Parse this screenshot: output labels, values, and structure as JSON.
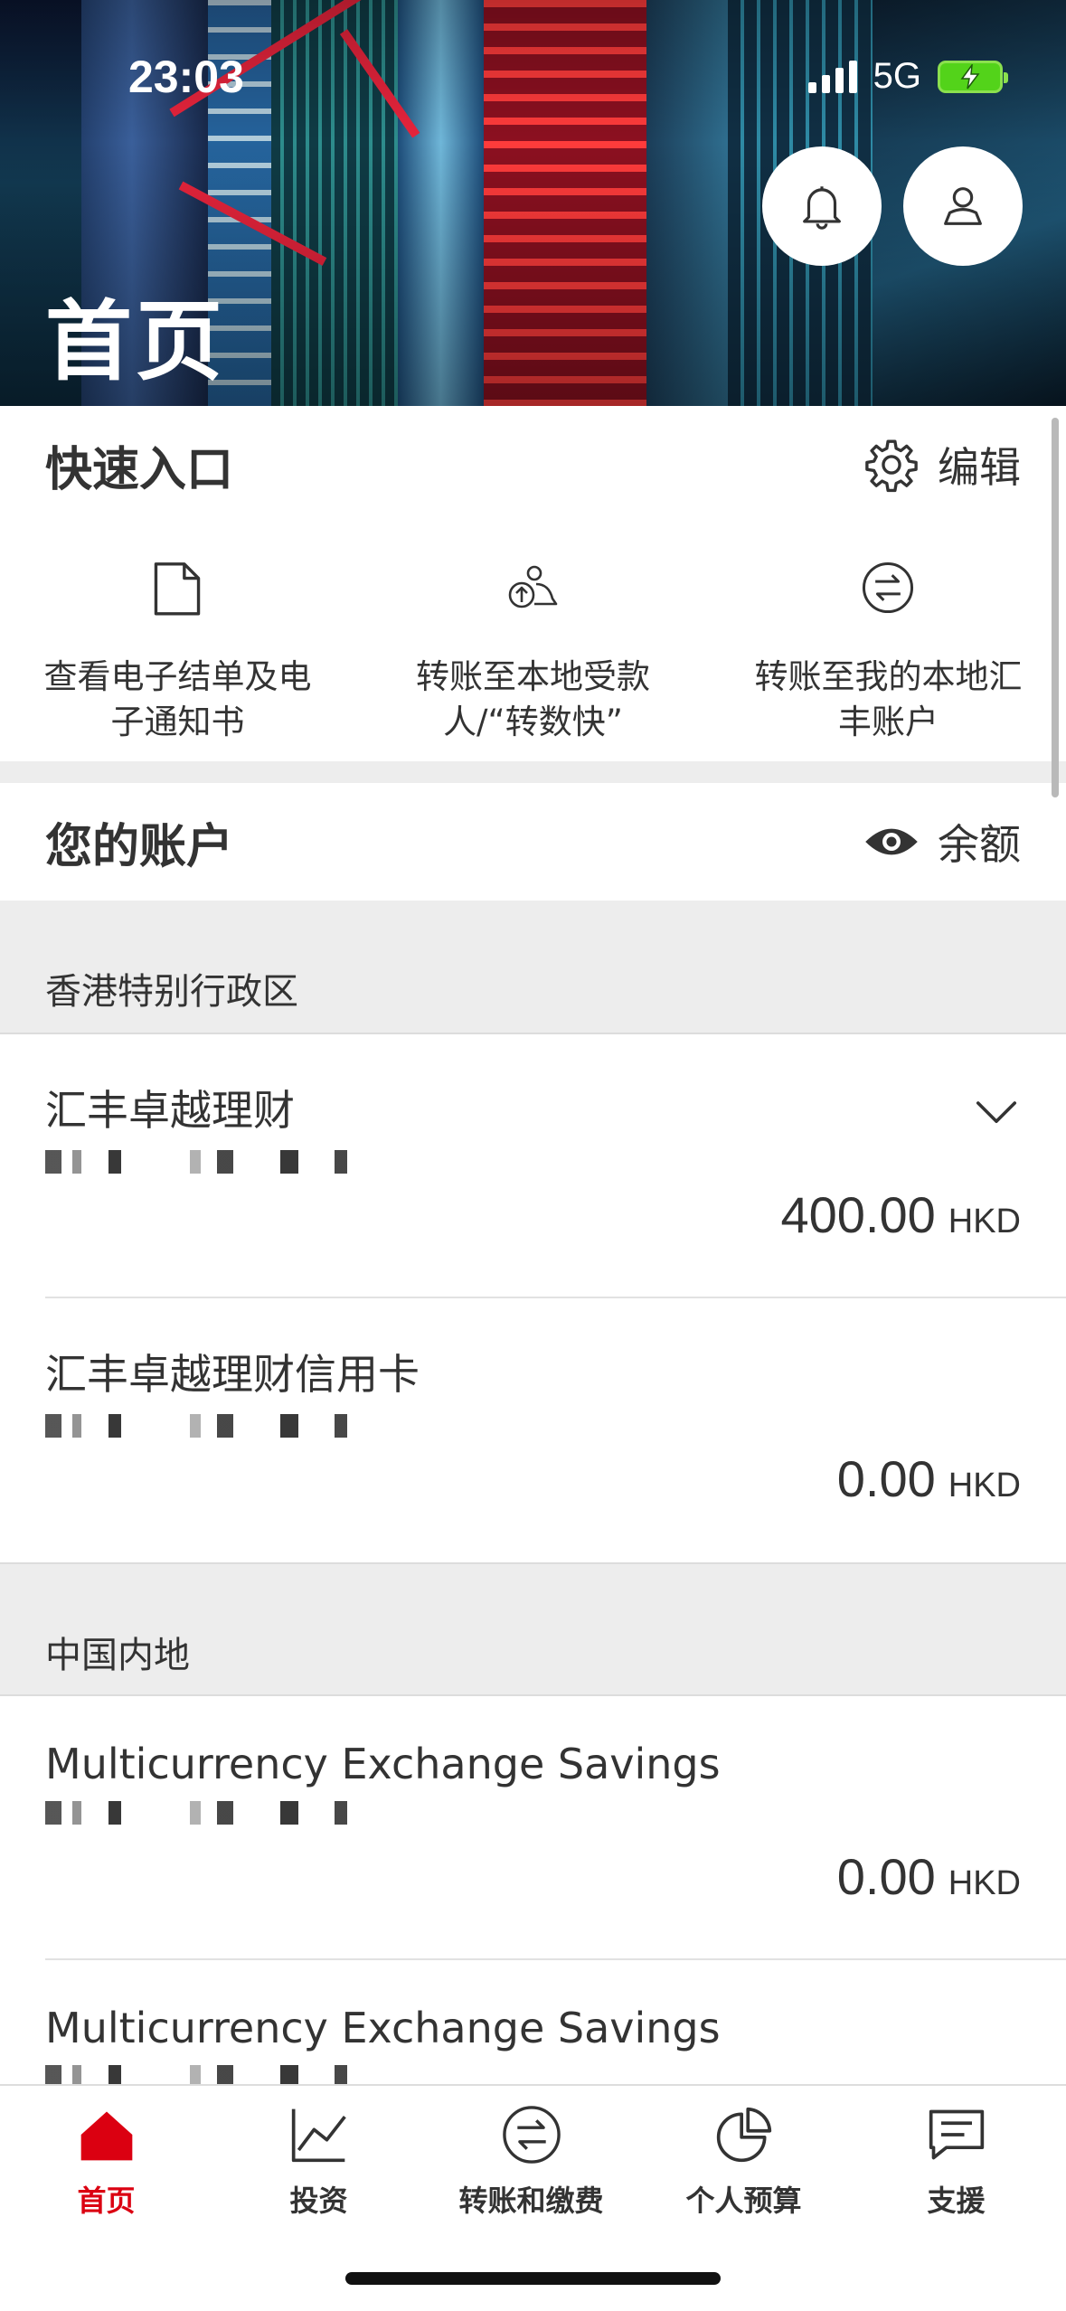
{
  "status_bar": {
    "time": "23:03",
    "network": "5G"
  },
  "header": {
    "title": "首页"
  },
  "quick_access": {
    "title": "快速入口",
    "edit_label": "编辑",
    "items": [
      {
        "label": "查看电子结单及电子通知书",
        "icon": "document-icon"
      },
      {
        "label": "转账至本地受款人/“转数快”",
        "icon": "transfer-payee-icon"
      },
      {
        "label": "转账至我的本地汇丰账户",
        "icon": "transfer-arrows-icon"
      }
    ]
  },
  "accounts": {
    "title": "您的账户",
    "balance_toggle_label": "余额",
    "regions": [
      {
        "name": "香港特别行政区",
        "items": [
          {
            "name": "汇丰卓越理财",
            "amount": "400.00",
            "currency": "HKD"
          },
          {
            "name": "汇丰卓越理财信用卡",
            "amount": "0.00",
            "currency": "HKD"
          }
        ]
      },
      {
        "name": "中国内地",
        "items": [
          {
            "name": "Multicurrency Exchange Savings",
            "amount": "0.00",
            "currency": "HKD"
          },
          {
            "name": "Multicurrency Exchange Savings"
          }
        ]
      }
    ]
  },
  "tabbar": {
    "items": [
      {
        "label": "首页",
        "active": true
      },
      {
        "label": "投资"
      },
      {
        "label": "转账和缴费"
      },
      {
        "label": "个人预算"
      },
      {
        "label": "支援"
      }
    ]
  },
  "colors": {
    "brand_red": "#db0011",
    "text": "#333333",
    "band": "#ededed"
  }
}
